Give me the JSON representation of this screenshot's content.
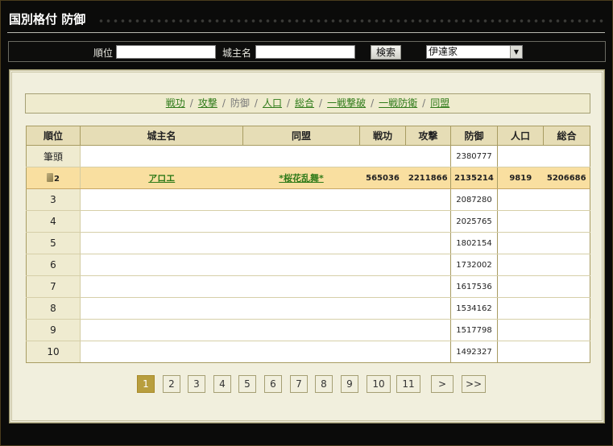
{
  "header": {
    "title": "国別格付 防御"
  },
  "search": {
    "rank_label": "順位",
    "rank_value": "",
    "lord_label": "城主名",
    "lord_value": "",
    "button_label": "検索",
    "clan_selected": "伊達家"
  },
  "nav": {
    "tabs": [
      {
        "label": "戦功",
        "active": false
      },
      {
        "label": "攻撃",
        "active": false
      },
      {
        "label": "防御",
        "active": true
      },
      {
        "label": "人口",
        "active": false
      },
      {
        "label": "総合",
        "active": false
      },
      {
        "label": "一戦撃破",
        "active": false
      },
      {
        "label": "一戦防衛",
        "active": false
      },
      {
        "label": "同盟",
        "active": false
      }
    ],
    "separator": "/"
  },
  "table": {
    "headers": [
      "順位",
      "城主名",
      "同盟",
      "戦功",
      "攻撃",
      "防御",
      "人口",
      "総合"
    ],
    "rows": [
      {
        "rank": "筆頭",
        "lord": "",
        "alliance": "",
        "merit": "",
        "attack": "",
        "defense": "2380777",
        "population": "",
        "total": ""
      },
      {
        "rank": "2",
        "lord": "アロエ",
        "alliance": "*桜花乱舞*",
        "merit": "565036",
        "attack": "2211866",
        "defense": "2135214",
        "population": "9819",
        "total": "5206686",
        "highlight": true
      },
      {
        "rank": "3",
        "lord": "",
        "alliance": "",
        "merit": "",
        "attack": "",
        "defense": "2087280",
        "population": "",
        "total": ""
      },
      {
        "rank": "4",
        "lord": "",
        "alliance": "",
        "merit": "",
        "attack": "",
        "defense": "2025765",
        "population": "",
        "total": ""
      },
      {
        "rank": "5",
        "lord": "",
        "alliance": "",
        "merit": "",
        "attack": "",
        "defense": "1802154",
        "population": "",
        "total": ""
      },
      {
        "rank": "6",
        "lord": "",
        "alliance": "",
        "merit": "",
        "attack": "",
        "defense": "1732002",
        "population": "",
        "total": ""
      },
      {
        "rank": "7",
        "lord": "",
        "alliance": "",
        "merit": "",
        "attack": "",
        "defense": "1617536",
        "population": "",
        "total": ""
      },
      {
        "rank": "8",
        "lord": "",
        "alliance": "",
        "merit": "",
        "attack": "",
        "defense": "1534162",
        "population": "",
        "total": ""
      },
      {
        "rank": "9",
        "lord": "",
        "alliance": "",
        "merit": "",
        "attack": "",
        "defense": "1517798",
        "population": "",
        "total": ""
      },
      {
        "rank": "10",
        "lord": "",
        "alliance": "",
        "merit": "",
        "attack": "",
        "defense": "1492327",
        "population": "",
        "total": ""
      }
    ]
  },
  "pagination": {
    "pages": [
      "1",
      "2",
      "3",
      "4",
      "5",
      "6",
      "7",
      "8",
      "9",
      "10",
      "11"
    ],
    "current": "1",
    "next_label": ">",
    "last_label": ">>"
  },
  "colors": {
    "background": "#0b0b0a",
    "panel": "#f1efdd",
    "header_cell": "#e6ddb6",
    "highlight_row": "#f9dfa0",
    "link": "#2e7a18",
    "active_page": "#b89e3e"
  }
}
